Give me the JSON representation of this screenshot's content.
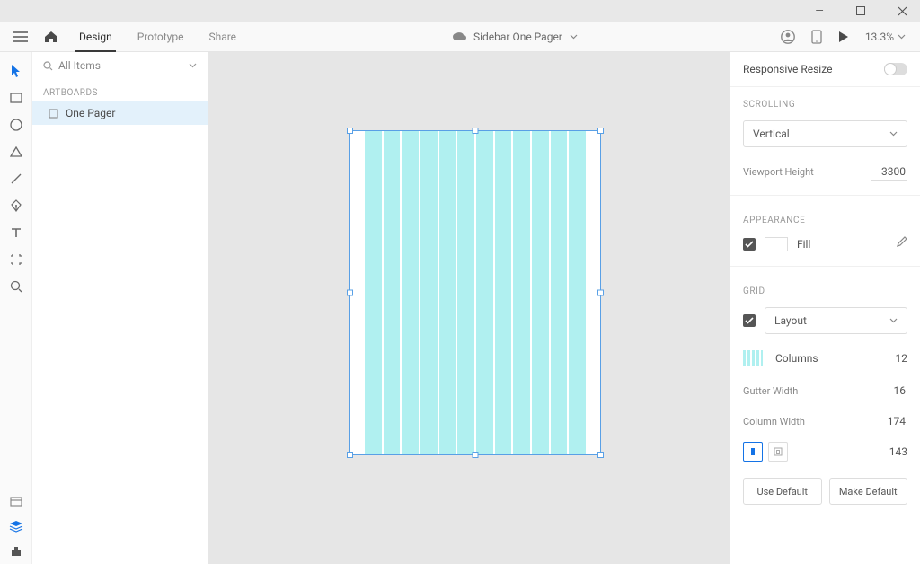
{
  "window": {
    "minimize": "—",
    "maximize": "□",
    "close": "×"
  },
  "topbar": {
    "tabs": {
      "design": "Design",
      "prototype": "Prototype",
      "share": "Share"
    },
    "doc_title": "Sidebar One Pager",
    "zoom": "13.3%"
  },
  "leftpanel": {
    "all_items": "All Items",
    "artboards_header": "ARTBOARDS",
    "items": [
      {
        "label": "One Pager"
      }
    ]
  },
  "rightpanel": {
    "responsive": "Responsive Resize",
    "scrolling_header": "SCROLLING",
    "scroll_mode": "Vertical",
    "viewport_label": "Viewport Height",
    "viewport_value": "3300",
    "appearance_header": "APPEARANCE",
    "fill_label": "Fill",
    "grid_header": "GRID",
    "grid_mode": "Layout",
    "columns_label": "Columns",
    "columns_value": "12",
    "gutter_label": "Gutter Width",
    "gutter_value": "16",
    "colwidth_label": "Column Width",
    "colwidth_value": "174",
    "margin_value": "143",
    "use_default": "Use Default",
    "make_default": "Make Default"
  }
}
